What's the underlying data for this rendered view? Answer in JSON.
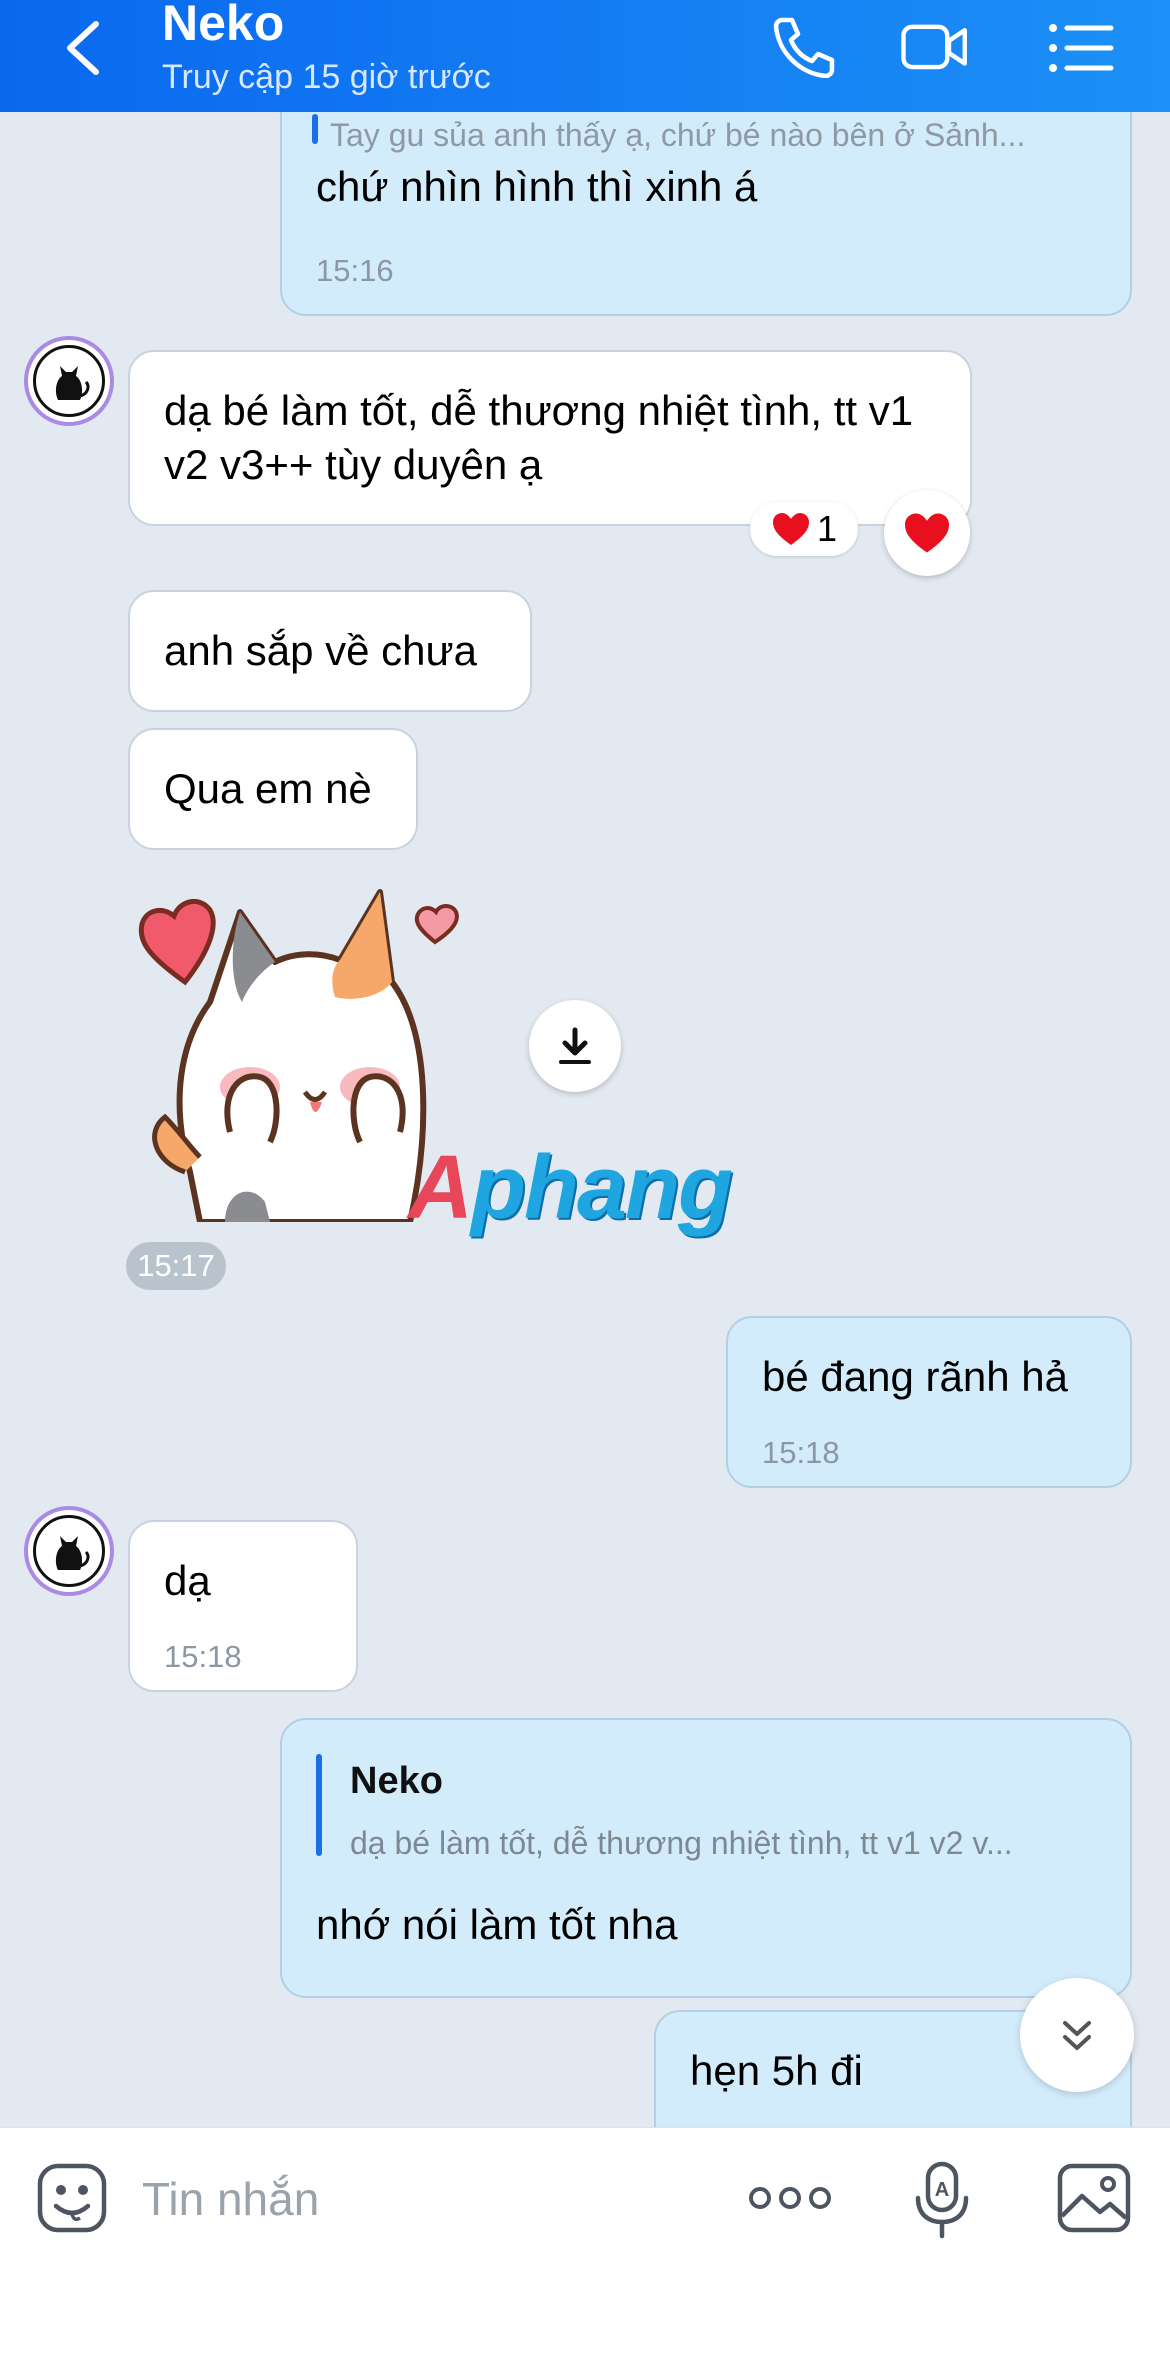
{
  "header": {
    "contact_name": "Neko",
    "status": "Truy cập 15 giờ trước",
    "accent_color": "#0a68ef"
  },
  "messages": {
    "m1": {
      "reply_preview": "Tay gu sủa anh thấy ạ, chứ bé nào bên ở Sảnh...",
      "text": "chứ nhìn hình thì xinh á",
      "time": "15:16"
    },
    "m2": {
      "text": "dạ bé làm tốt, dễ thương nhiệt tình, tt v1 v2 v3++ tùy duyên ạ",
      "reaction_count": "1"
    },
    "m3": {
      "text": "anh sắp về chưa"
    },
    "m4": {
      "text": "Qua em nè"
    },
    "sticker": {
      "name": "cat-shy-sticker",
      "time": "15:17",
      "watermark_a": "A",
      "watermark_rest": "phang"
    },
    "m5": {
      "text": "bé đang rãnh hả",
      "time": "15:18"
    },
    "m6": {
      "text": "dạ",
      "time": "15:18"
    },
    "m7": {
      "quote_name": "Neko",
      "quote_text": "dạ bé làm tốt, dễ thương nhiệt tình, tt v1 v2 v...",
      "text": "nhớ nói làm tốt nha"
    },
    "m8": {
      "text": "hẹn 5h đi"
    }
  },
  "input": {
    "placeholder": "Tin nhắn"
  },
  "icons": [
    "back-icon",
    "phone-icon",
    "video-call-icon",
    "list-menu-icon",
    "heart-icon",
    "download-icon",
    "chevron-double-down-icon",
    "emoji-icon",
    "more-icon",
    "voice-to-text-icon",
    "image-icon"
  ]
}
